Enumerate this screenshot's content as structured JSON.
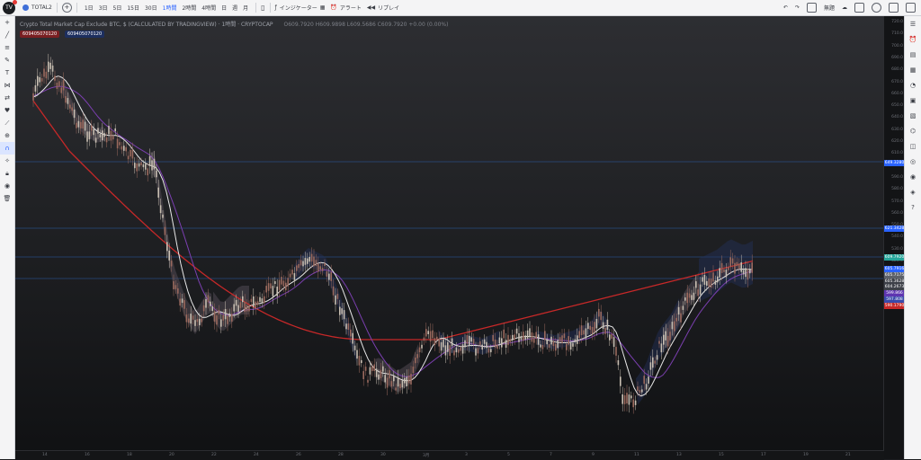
{
  "topbar": {
    "symbol": "TOTAL2",
    "timeframes": [
      "1日",
      "3日",
      "5日",
      "15日",
      "30日",
      "1時間",
      "2時間",
      "4時間",
      "日",
      "週",
      "月"
    ],
    "active_timeframe": "1時間",
    "indicators_label": "インジケーター",
    "alert_label": "アラート",
    "replay_label": "リプレイ",
    "layout_label": "無題"
  },
  "legend": {
    "title": "Crypto Total Market Cap Exclude BTC, $ (CALCULATED BY TRADINGVIEW) · 1時間 · CRYPTOCAP",
    "ohlc": "O609.7920 H609.9898 L609.5686 C609.7920 +0.00 (0.00%)",
    "indicator_a": "609405070120",
    "indicator_b": "609405070120"
  },
  "price_axis": {
    "ticks": [
      "720.0",
      "710.0",
      "700.0",
      "690.0",
      "680.0",
      "670.0",
      "660.0",
      "650.0",
      "640.0",
      "630.0",
      "620.0",
      "610.0",
      "600.0",
      "590.0",
      "580.0",
      "570.0",
      "560.0",
      "550.0",
      "540.0",
      "530.0",
      "520.0",
      "510.0"
    ],
    "labels": [
      {
        "value": "649.3280",
        "color": "#2962ff"
      },
      {
        "value": "621.3428",
        "color": "#2962ff"
      },
      {
        "value": "609.7920",
        "color": "#26a69a"
      },
      {
        "value": "605.7916",
        "color": "#2962ff"
      },
      {
        "value": "605.7175",
        "color": "#5d616a"
      },
      {
        "value": "605.3628",
        "color": "#3d4048"
      },
      {
        "value": "604.2673",
        "color": "#3d4048"
      },
      {
        "value": "599.866",
        "color": "#5e35b1"
      },
      {
        "value": "597.808",
        "color": "#3949ab"
      },
      {
        "value": "590.1790",
        "color": "#c62828"
      }
    ]
  },
  "time_axis": {
    "ticks": [
      "14",
      "16",
      "18",
      "20",
      "22",
      "24",
      "26",
      "28",
      "30",
      "3月",
      "3",
      "5",
      "7",
      "9",
      "11",
      "13",
      "15",
      "17",
      "19",
      "21"
    ]
  },
  "colors": {
    "hline": "#2f6fd0",
    "ma_slow": "#c62828",
    "ma_mid": "#7b3fb0",
    "ma_fast": "#e8e8e8",
    "cloud_bear": "#5d5560",
    "cloud_bull": "#24305a"
  }
}
